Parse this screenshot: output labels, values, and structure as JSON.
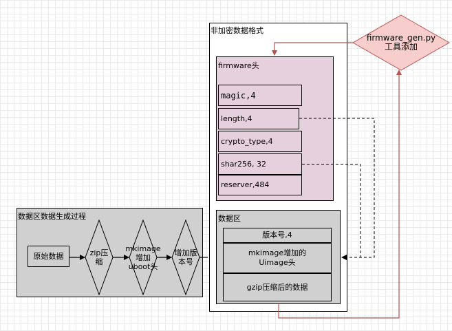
{
  "diagram": {
    "plain_format": {
      "title": "非加密数据格式"
    },
    "firmware_header": {
      "title": "firmware头",
      "fields": [
        "magic,4",
        "length,4",
        "crypto_type,4",
        "shar256, 32",
        "reserver,484"
      ]
    },
    "data_region": {
      "title": "数据区",
      "items": [
        "版本号,4",
        "mkimage增加的\nUimage头",
        "gzip压缩后的数据"
      ]
    },
    "gen_process": {
      "title": "数据区数据生成过程",
      "start": "原始数据",
      "steps": [
        "zip压\n缩",
        "mkimage\n增加\nuboot头",
        "增加版\n本号"
      ]
    },
    "tool": {
      "label": "firmware_gen.py\n工具添加"
    }
  }
}
